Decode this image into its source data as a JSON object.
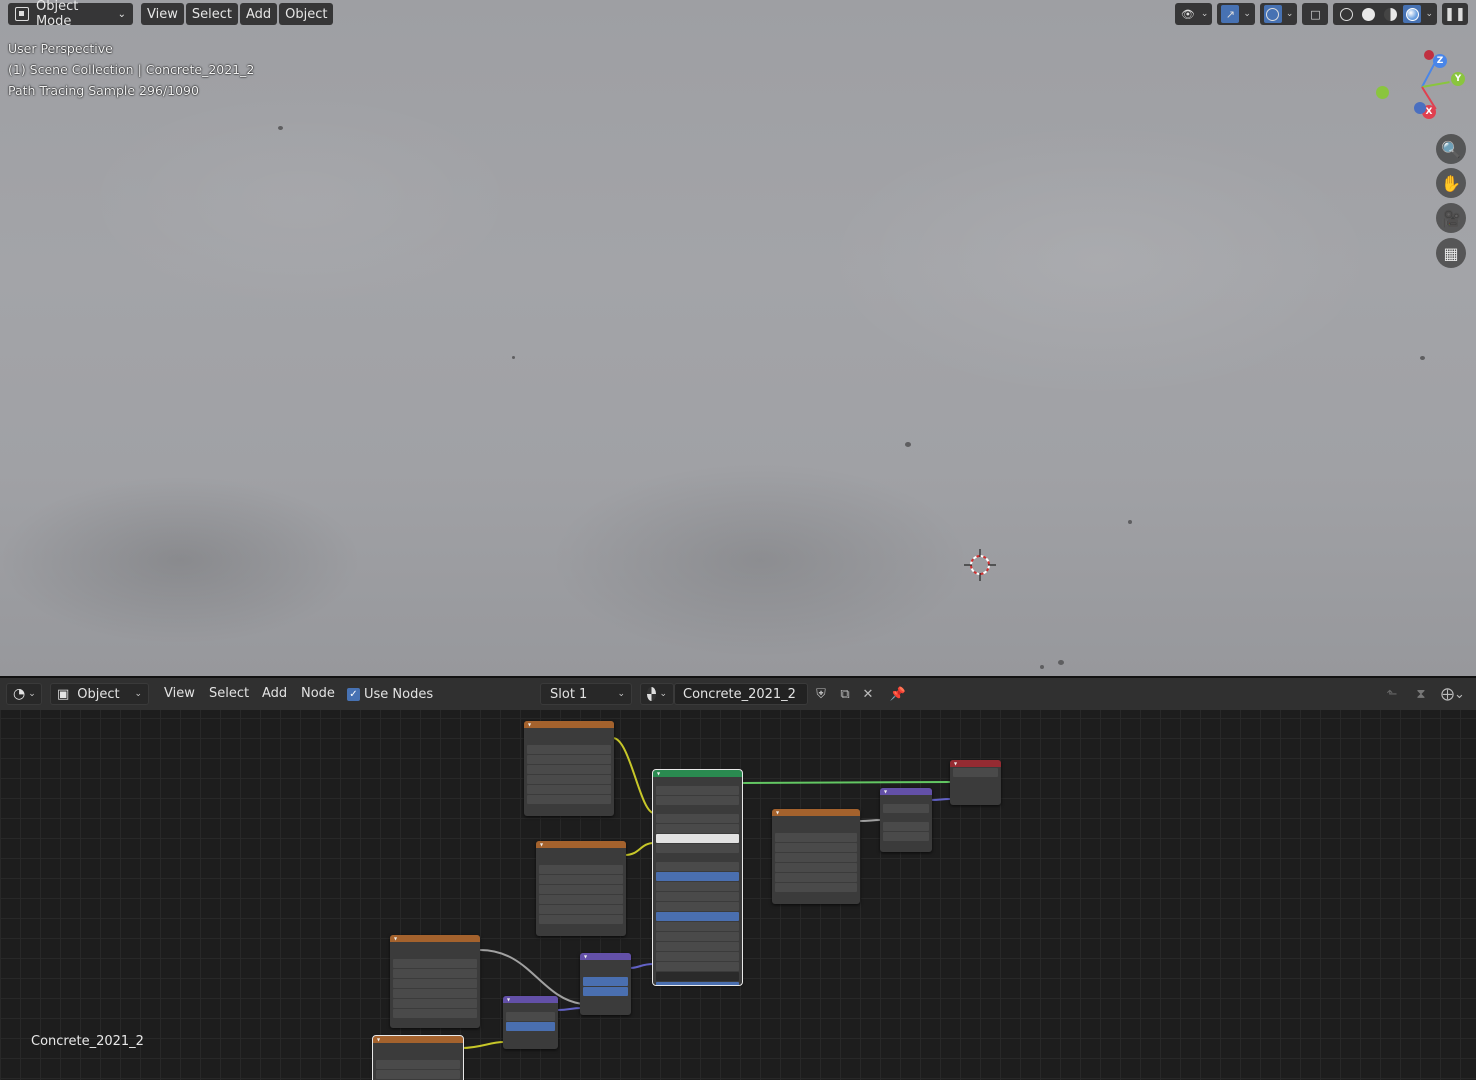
{
  "viewport": {
    "mode_label": "Object Mode",
    "menus": [
      "View",
      "Select",
      "Add",
      "Object"
    ],
    "overlay": {
      "line1": "User Perspective",
      "line2": "(1) Scene Collection | Concrete_2021_2",
      "line3": "Path Tracing Sample 296/1090"
    },
    "gizmo": {
      "z": "Z",
      "y": "Y",
      "x": "X"
    },
    "colors": {
      "x_axis": "#e04050",
      "y_axis": "#8ac53e",
      "z_axis": "#4a86e8"
    }
  },
  "node_editor": {
    "editor_type_icon": "shader-editor-icon",
    "object_label": "Object",
    "menus": [
      "View",
      "Select",
      "Add",
      "Node"
    ],
    "use_nodes_label": "Use Nodes",
    "slot_label": "Slot 1",
    "material_name": "Concrete_2021_2",
    "footer_material": "Concrete_2021_2",
    "colors": {
      "image_header": "#a4622d",
      "shader_header": "#2a8a50",
      "vector_header": "#6350a8",
      "output_header": "#952b32"
    }
  }
}
